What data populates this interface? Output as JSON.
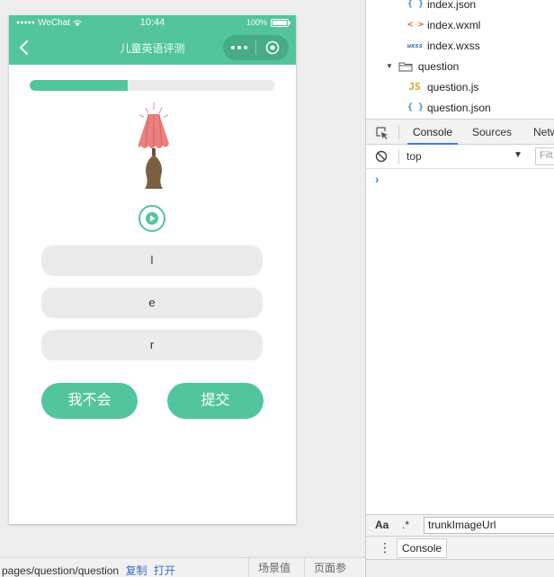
{
  "status_bar": {
    "carrier": "WeChat",
    "time": "10:44",
    "battery": "100%"
  },
  "nav": {
    "title": "儿童英语评测"
  },
  "progress": {
    "fraction": 0.4
  },
  "answers": [
    "l",
    "e",
    "r"
  ],
  "buttons": {
    "skip": "我不会",
    "submit": "提交"
  },
  "bottom_bar": {
    "path": "pages/question/question",
    "copy": "复制",
    "open": "打开",
    "scene": "场景值",
    "params": "页面参数"
  },
  "file_tree": {
    "items": [
      {
        "icon": "{ }",
        "name": "index.json"
      },
      {
        "icon": "< >",
        "name": "index.wxml"
      },
      {
        "icon": "wxss",
        "name": "index.wxss"
      },
      {
        "icon": "folder",
        "name": "question"
      },
      {
        "icon": "JS",
        "name": "question.js"
      },
      {
        "icon": "{ }",
        "name": "question.json"
      }
    ]
  },
  "devtools": {
    "tabs": [
      "Console",
      "Sources",
      "Netwo"
    ],
    "context": "top",
    "filter_placeholder": "Filt",
    "prompt": "›",
    "search": {
      "case_label": "Aa",
      "regex_label": ".*",
      "value": "trunkImageUrl"
    },
    "drawer_tab": "Console"
  },
  "colors": {
    "accent": "#52c69a",
    "link": "#3c6fc4",
    "devtools_blue": "#3d7de4"
  }
}
